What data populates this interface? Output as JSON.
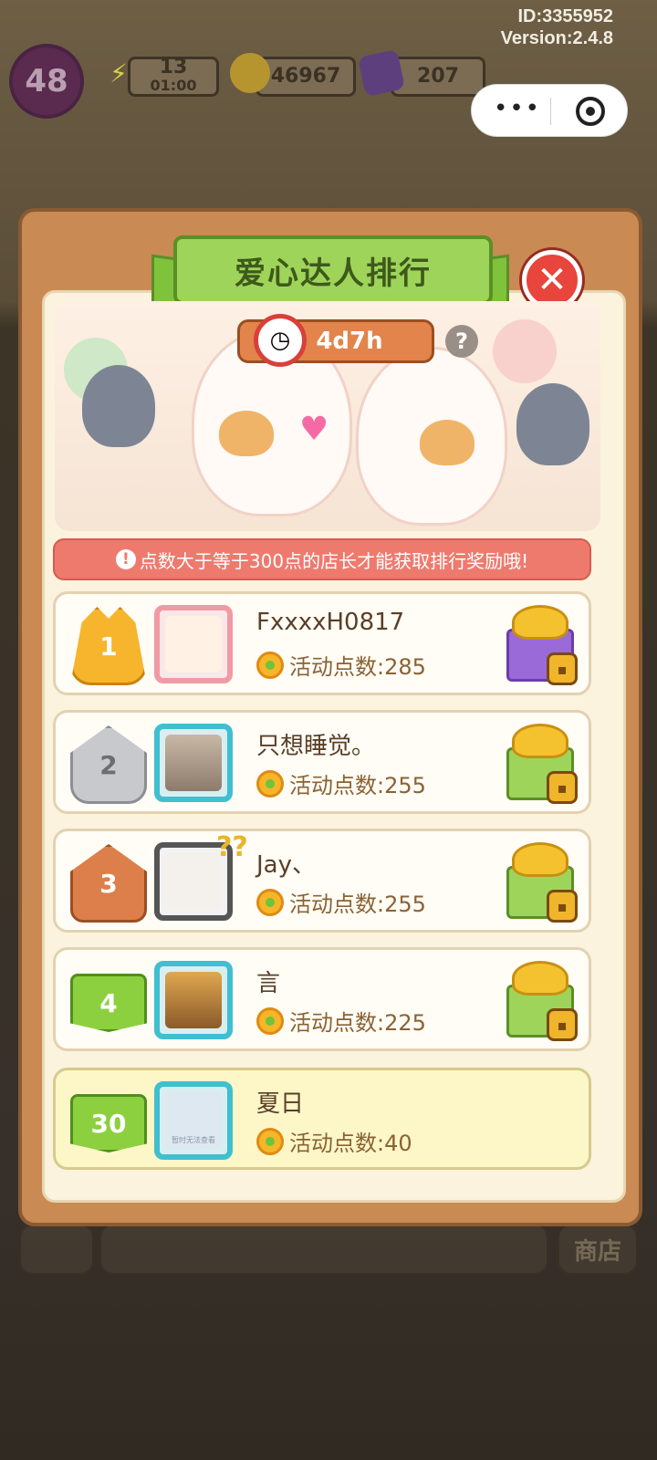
{
  "meta": {
    "id_line": "ID:3355952",
    "version_line": "Version:2.4.8"
  },
  "hud": {
    "level": "48",
    "energy_count": "13",
    "energy_timer": "01:00",
    "coins": "46967",
    "gems": "207",
    "energy_icon": "lightning-icon",
    "coin_icon": "coin-icon",
    "gem_icon": "gem-icon"
  },
  "dialog": {
    "title": "爱心达人排行",
    "countdown": "4d7h",
    "help_label": "?",
    "notice": "点数大于等于300点的店长才能获取排行奖励哦!",
    "close_label": "✕"
  },
  "ranking": [
    {
      "rank": "1",
      "name": "FxxxxH0817",
      "points_label": "活动点数:285",
      "gift": "purple"
    },
    {
      "rank": "2",
      "name": "只想睡觉。",
      "points_label": "活动点数:255",
      "gift": "green"
    },
    {
      "rank": "3",
      "name": "Jay、",
      "points_label": "活动点数:255",
      "gift": "green"
    },
    {
      "rank": "4",
      "name": "言",
      "points_label": "活动点数:225",
      "gift": "green"
    }
  ],
  "my_rank": {
    "rank": "30",
    "name": "夏日",
    "points_label": "活动点数:40",
    "avatar_text": "暂时无法查看"
  },
  "bottom_bar": {
    "shop_label": "商店"
  },
  "colors": {
    "panel": "#c98a54",
    "title_green": "#9fd45a",
    "notice_red": "#ee7a6e",
    "close_red": "#e8453c"
  }
}
